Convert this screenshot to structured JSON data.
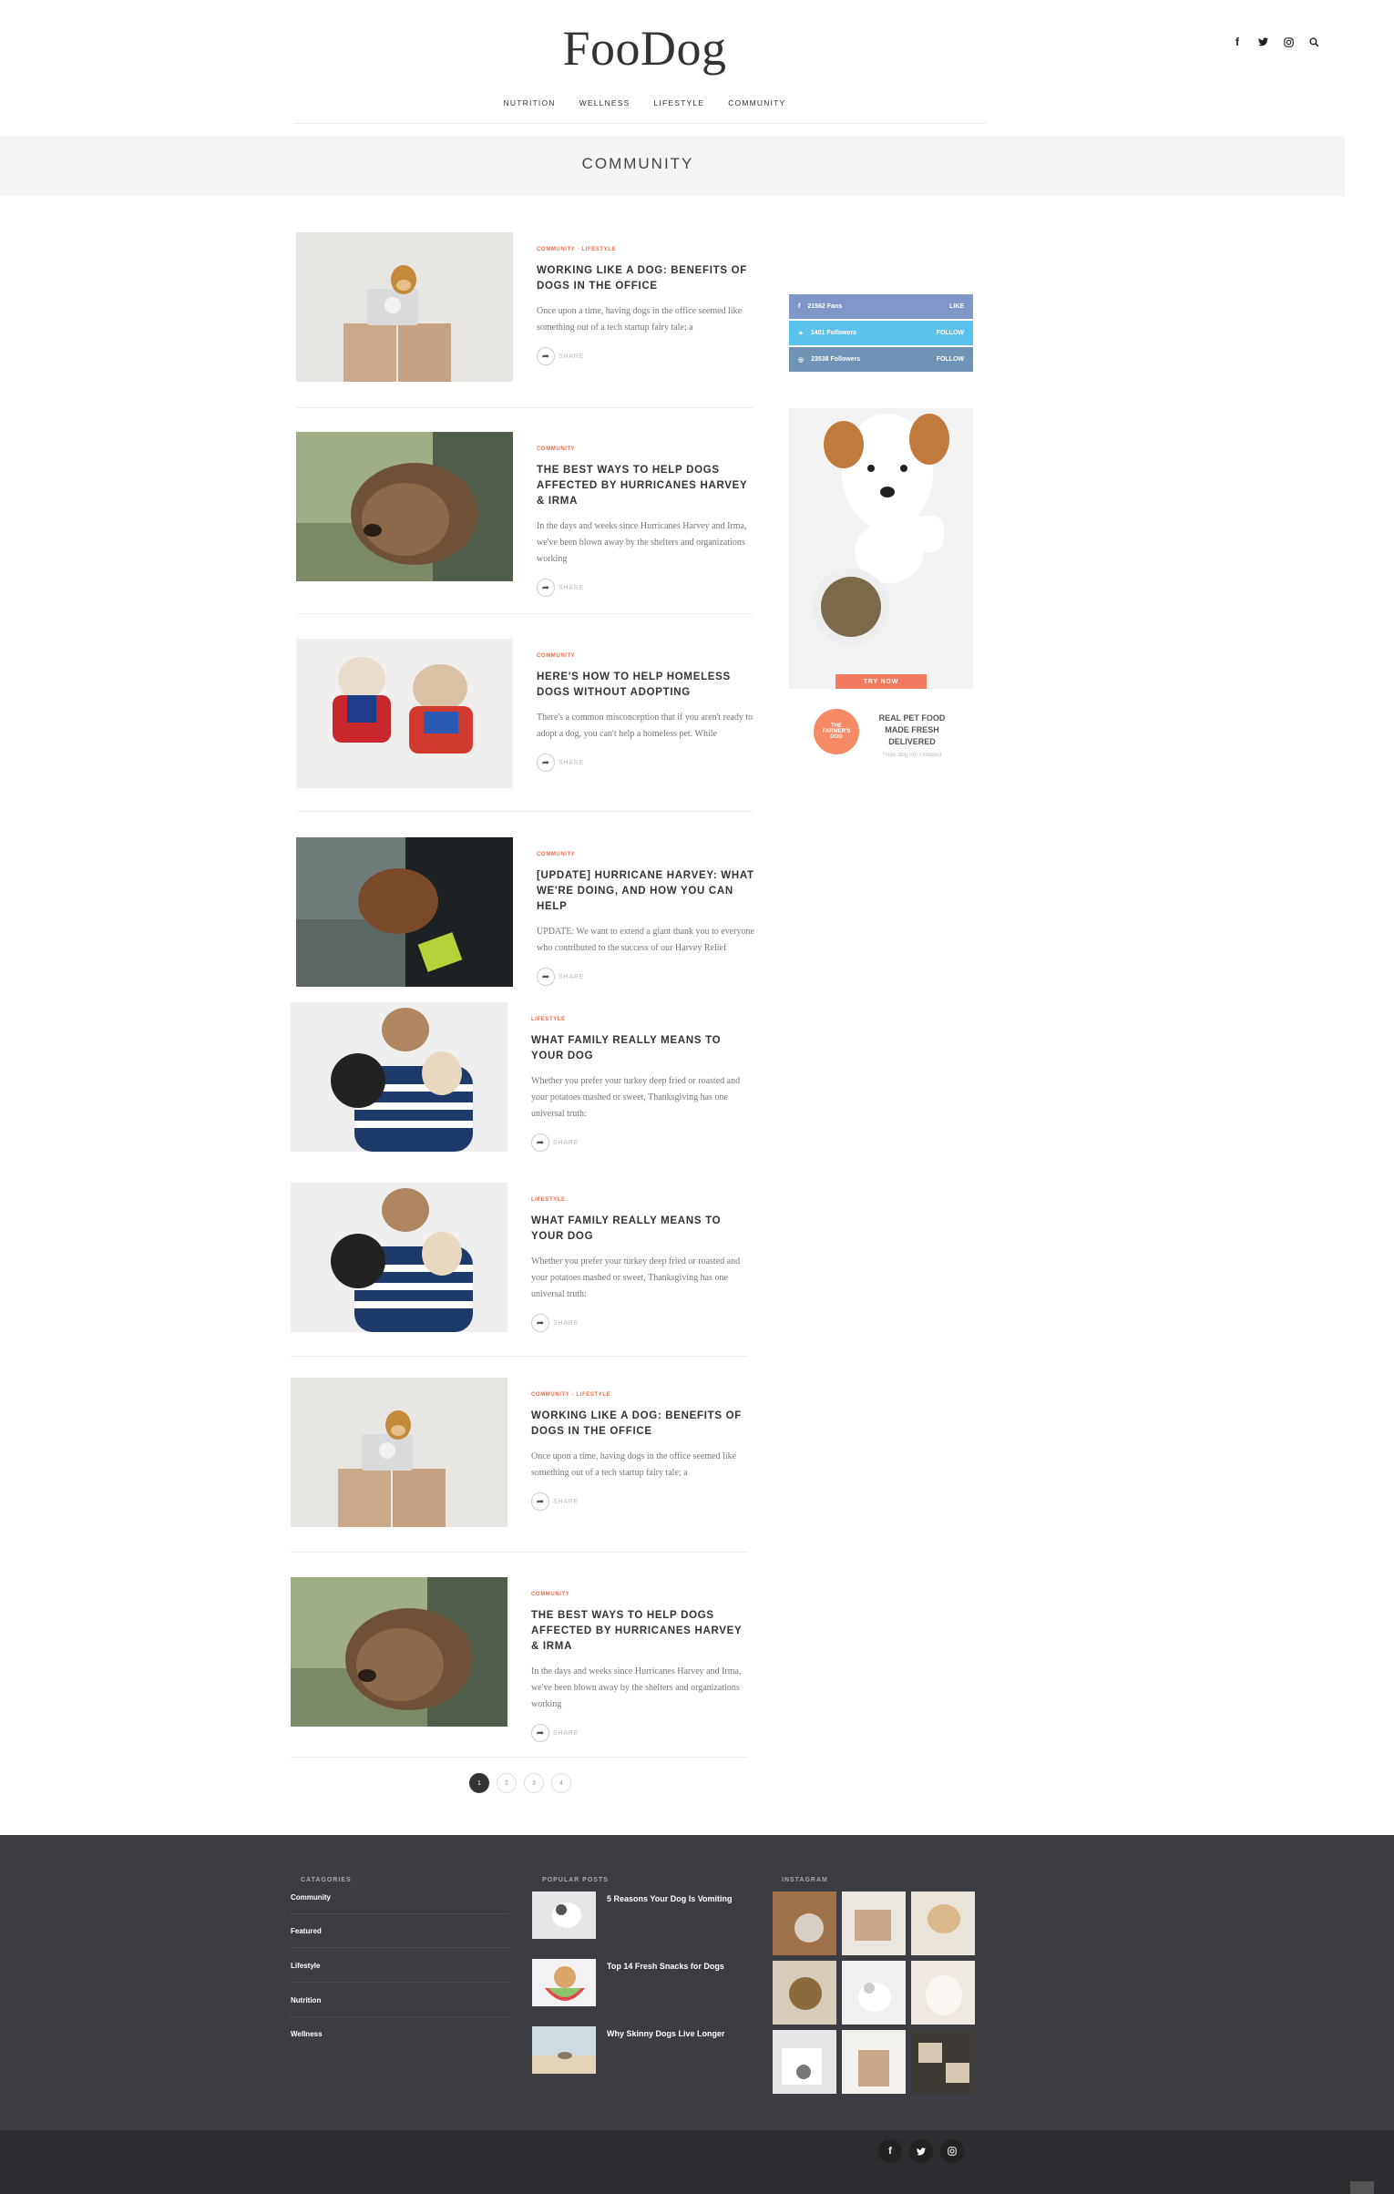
{
  "brand": {
    "logo": "FooDog"
  },
  "top_icons": [
    "facebook-icon",
    "twitter-icon",
    "instagram-icon",
    "search-icon"
  ],
  "nav": {
    "items": [
      "NUTRITION",
      "WELLNESS",
      "LIFESTYLE",
      "COMMUNITY"
    ]
  },
  "page_title": "COMMUNITY",
  "colors": {
    "accent": "#f06a4a",
    "facebook": "#8196c9",
    "twitter": "#5bc2ee",
    "instagram": "#6f93b4",
    "footer": "#3b3d42"
  },
  "posts": [
    {
      "cats": "COMMUNITY · LIFESTYLE",
      "title": "WORKING LIKE A DOG: BENEFITS OF DOGS IN THE OFFICE",
      "excerpt": "Once upon a time, having dogs in the office seemed like something out of a tech startup fairy tale; a",
      "share": "SHARE"
    },
    {
      "cats": "COMMUNITY",
      "title": "THE BEST WAYS TO HELP DOGS AFFECTED BY HURRICANES HARVEY & IRMA",
      "excerpt": "In the days and weeks since Hurricanes Harvey and Irma, we've been blown away by the shelters and organizations working",
      "share": "SHARE"
    },
    {
      "cats": "COMMUNITY",
      "title": "HERE'S HOW TO HELP HOMELESS DOGS WITHOUT ADOPTING",
      "excerpt": "There's a common misconception that if you aren't ready to adopt a dog, you can't help a homeless pet. While",
      "share": "SHARE"
    },
    {
      "cats": "COMMUNITY",
      "title": "[UPDATE] HURRICANE HARVEY: WHAT WE'RE DOING, AND HOW YOU CAN HELP",
      "excerpt": "UPDATE: We want to extend a giant thank you to everyone who contributed to the success of our Harvey Relief",
      "share": "SHARE"
    },
    {
      "cats": "LIFESTYLE",
      "title": "WHAT FAMILY REALLY MEANS TO YOUR DOG",
      "excerpt": "Whether you prefer your turkey deep fried or roasted and your potatoes mashed or sweet, Thanksgiving has one universal truth:",
      "share": "SHARE"
    },
    {
      "cats": "LIFESTYLE",
      "title": "WHAT FAMILY REALLY MEANS TO YOUR DOG",
      "excerpt": "Whether you prefer your turkey deep fried or roasted and your potatoes mashed or sweet, Thanksgiving has one universal truth:",
      "share": "SHARE"
    },
    {
      "cats": "COMMUNITY · LIFESTYLE",
      "title": "WORKING LIKE A DOG: BENEFITS OF DOGS IN THE OFFICE",
      "excerpt": "Once upon a time, having dogs in the office seemed like something out of a tech startup fairy tale; a",
      "share": "SHARE"
    },
    {
      "cats": "COMMUNITY",
      "title": "THE BEST WAYS TO HELP DOGS AFFECTED BY HURRICANES HARVEY & IRMA",
      "excerpt": "In the days and weeks since Hurricanes Harvey and Irma, we've been blown away by the shelters and organizations working",
      "share": "SHARE"
    }
  ],
  "social_counters": [
    {
      "count": "21562 Fans",
      "action": "LIKE"
    },
    {
      "count": "1401 Followers",
      "action": "FOLLOW"
    },
    {
      "count": "23538 Followers",
      "action": "FOLLOW"
    }
  ],
  "ad": {
    "button": "TRY NOW",
    "brand": "THE FARMER'S DOG",
    "headline": "REAL PET FOOD MADE FRESH DELIVERED",
    "note": "*cute dog not included"
  },
  "pagination": [
    "1",
    "2",
    "3",
    "4"
  ],
  "footer": {
    "categories_head": "CATAGORIES",
    "categories": [
      "Community",
      "Featured",
      "Lifestyle",
      "Nutrition",
      "Wellness"
    ],
    "popular_head": "POPULAR POSTS",
    "popular": [
      "5 Reasons Your Dog Is Vomiting",
      "Top 14 Fresh Snacks for Dogs",
      "Why Skinny Dogs Live Longer"
    ],
    "instagram_head": "INSTAGRAM"
  }
}
